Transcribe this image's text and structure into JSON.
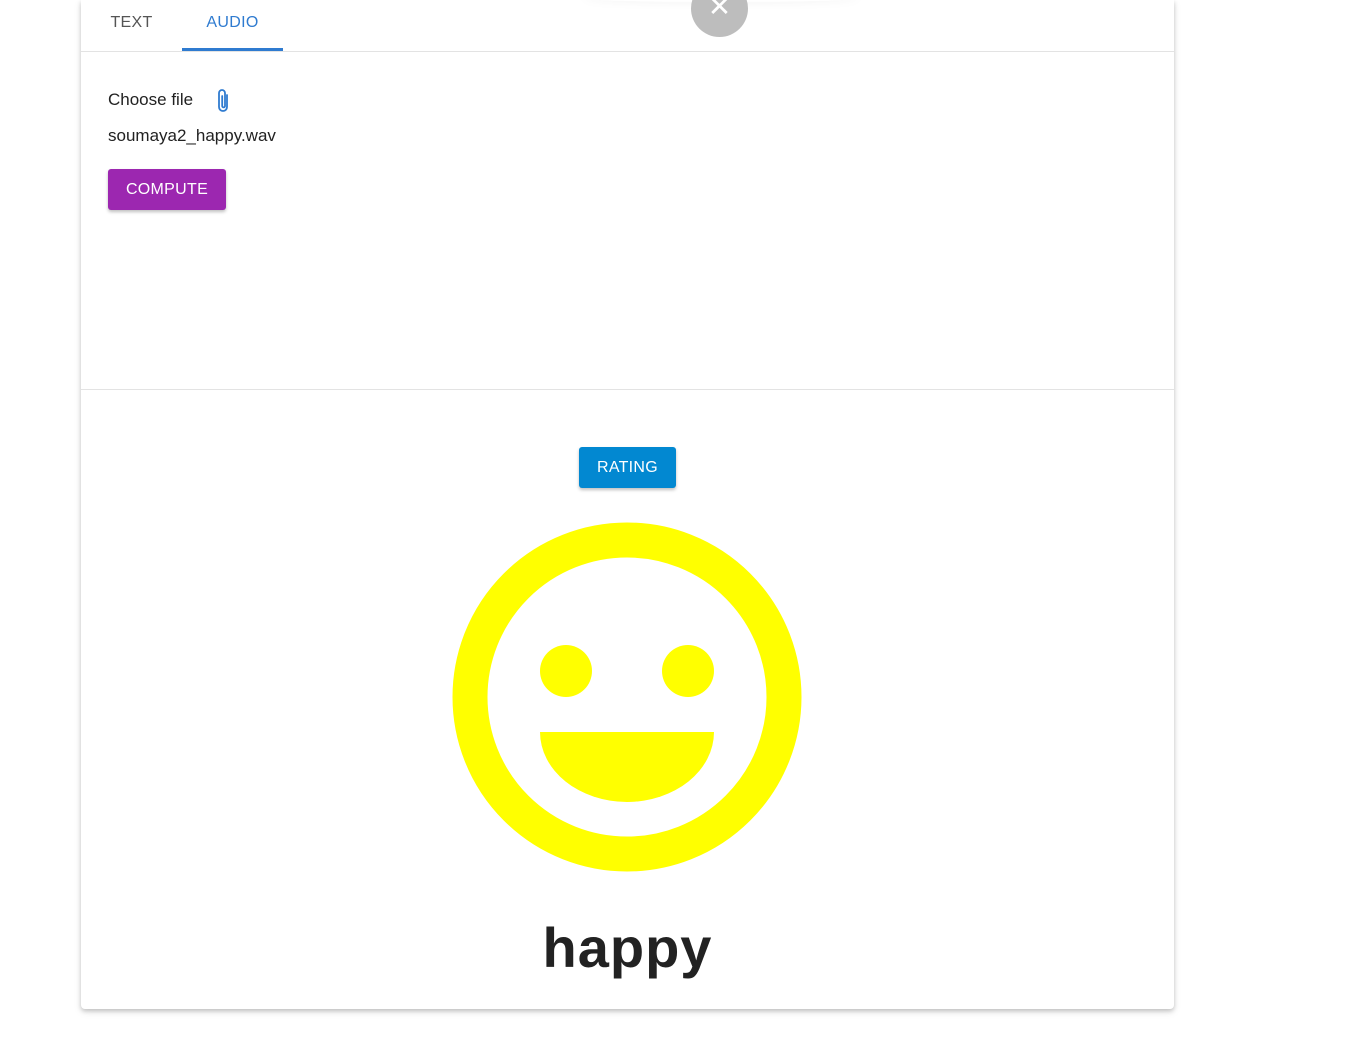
{
  "tabs": [
    {
      "label": "TEXT",
      "active": false
    },
    {
      "label": "AUDIO",
      "active": true
    }
  ],
  "close_icon": "close-icon",
  "close_glyph": "✕",
  "upload": {
    "choose_label": "Choose file",
    "attach_icon": "paperclip-icon",
    "file_name": "soumaya2_happy.wav",
    "compute_label": "COMPUTE"
  },
  "result": {
    "rating_label": "RATING",
    "emotion_icon": "happy-face-icon",
    "emotion": "happy"
  },
  "colors": {
    "accent_blue": "#2f7bd0",
    "compute_purple": "#9c27b0",
    "rating_blue": "#0288d1",
    "smiley_yellow": "#ffff00"
  }
}
